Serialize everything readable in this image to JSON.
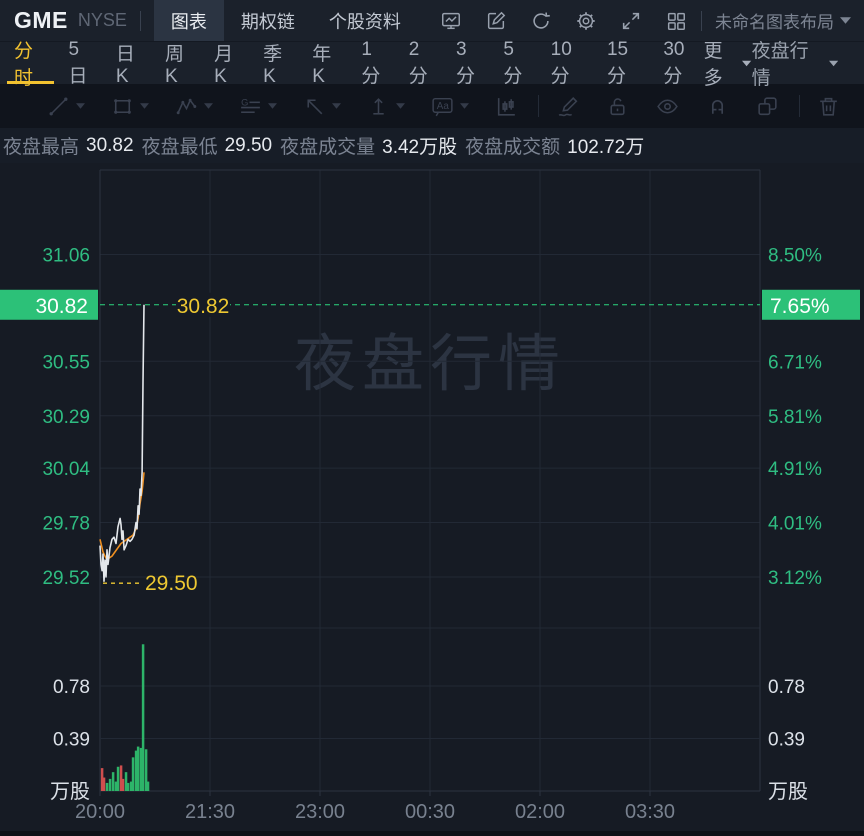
{
  "header": {
    "symbol": "GME",
    "exchange": "NYSE",
    "tabs": [
      {
        "label": "图表",
        "active": true
      },
      {
        "label": "期权链",
        "active": false
      },
      {
        "label": "个股资料",
        "active": false
      }
    ],
    "layout_name": "未命名图表布局"
  },
  "timeframe_bar": {
    "items": [
      {
        "label": "分时",
        "active": true
      },
      {
        "label": "5日"
      },
      {
        "label": "日K"
      },
      {
        "label": "周K"
      },
      {
        "label": "月K"
      },
      {
        "label": "季K"
      },
      {
        "label": "年K"
      },
      {
        "label": "1分"
      },
      {
        "label": "2分"
      },
      {
        "label": "3分"
      },
      {
        "label": "5分"
      },
      {
        "label": "10分"
      },
      {
        "label": "15分"
      },
      {
        "label": "30分"
      }
    ],
    "more_label": "更多",
    "session_selector": "夜盘行情"
  },
  "stats_bar": {
    "items": [
      {
        "label": "夜盘最高",
        "value": "30.82"
      },
      {
        "label": "夜盘最低",
        "value": "29.50"
      },
      {
        "label": "夜盘成交量",
        "value": "3.42万股"
      },
      {
        "label": "夜盘成交额",
        "value": "102.72万"
      }
    ]
  },
  "colors": {
    "text_green": "#2fbd82",
    "badge_green": "#2cc178",
    "dashed_green": "#2bd67e",
    "yellow": "#eec832",
    "orange_line": "#ee8f21",
    "price_line": "#e3e7eb",
    "vol_up_green": "#2db469",
    "vol_down_red": "#cf4e4e",
    "axis_time_text": "#78818f",
    "white_text": "#dce1e8",
    "grid": "#222935",
    "border": "#2c3340",
    "watermark": "#2c3442"
  },
  "chart_data": {
    "type": "line",
    "watermark": "夜盘行情",
    "x_ticks": [
      "20:00",
      "21:30",
      "23:00",
      "00:30",
      "02:00",
      "03:30"
    ],
    "session_minutes": 480,
    "y_axis": {
      "price_ticks": [
        "31.06",
        "30.55",
        "30.29",
        "30.04",
        "29.78",
        "29.52"
      ],
      "percent_ticks": [
        "8.50%",
        "6.71%",
        "5.81%",
        "4.91%",
        "4.01%",
        "3.12%"
      ],
      "price_top": 31.06,
      "price_bottom": 29.52,
      "current_price": "30.82",
      "current_percent": "7.65%",
      "current_price_value": 30.82
    },
    "markers": {
      "high": {
        "label": "30.82",
        "value": 30.82
      },
      "low": {
        "label": "29.50",
        "value": 29.5
      }
    },
    "volume_axis": {
      "ticks": [
        "0.78",
        "0.39"
      ],
      "values": [
        0.78,
        0.39
      ],
      "unit": "万股",
      "max": 1.2
    },
    "price_line": {
      "minutes": [
        0,
        0.7,
        1.5,
        2.2,
        2.9,
        3.6,
        4.4,
        5.1,
        5.8,
        7.3,
        8.7,
        10.2,
        11.6,
        13.1,
        14.6,
        15.3,
        16,
        16.7,
        17.5,
        18.9,
        20.4,
        21.8,
        23.3,
        24.8,
        26.2,
        26.9,
        27.7,
        28.4,
        29.1,
        29.8,
        30.6,
        31.3,
        32
      ],
      "price": [
        29.67,
        29.58,
        29.55,
        29.63,
        29.5,
        29.6,
        29.52,
        29.65,
        29.58,
        29.66,
        29.7,
        29.71,
        29.68,
        29.76,
        29.8,
        29.77,
        29.7,
        29.74,
        29.65,
        29.67,
        29.7,
        29.69,
        29.7,
        29.72,
        29.78,
        29.75,
        29.86,
        29.82,
        29.94,
        29.91,
        30.02,
        30.45,
        30.82
      ]
    },
    "avg_line": {
      "minutes": [
        0,
        2.2,
        4.4,
        6.5,
        8.7,
        10.9,
        13.1,
        15.3,
        17.5,
        19.6,
        21.8,
        24,
        26.2,
        27.7,
        29.1,
        30.6,
        31.3,
        32
      ],
      "price": [
        29.7,
        29.64,
        29.61,
        29.61,
        29.62,
        29.64,
        29.66,
        29.68,
        29.69,
        29.7,
        29.71,
        29.72,
        29.75,
        29.8,
        29.87,
        29.93,
        29.97,
        30.02
      ]
    },
    "volume_bars": [
      {
        "m": 1.5,
        "v": 0.17,
        "d": "down"
      },
      {
        "m": 2.9,
        "v": 0.1,
        "d": "down"
      },
      {
        "m": 5.1,
        "v": 0.06,
        "d": "up"
      },
      {
        "m": 7.3,
        "v": 0.09,
        "d": "up"
      },
      {
        "m": 9.5,
        "v": 0.14,
        "d": "up"
      },
      {
        "m": 11.6,
        "v": 0.07,
        "d": "up"
      },
      {
        "m": 13.1,
        "v": 0.18,
        "d": "up"
      },
      {
        "m": 15.3,
        "v": 0.19,
        "d": "down"
      },
      {
        "m": 16.7,
        "v": 0.09,
        "d": "down"
      },
      {
        "m": 18.9,
        "v": 0.14,
        "d": "up"
      },
      {
        "m": 20.4,
        "v": 0.06,
        "d": "up"
      },
      {
        "m": 22.6,
        "v": 0.07,
        "d": "up"
      },
      {
        "m": 24.0,
        "v": 0.25,
        "d": "up"
      },
      {
        "m": 26.2,
        "v": 0.3,
        "d": "up"
      },
      {
        "m": 27.7,
        "v": 0.33,
        "d": "up"
      },
      {
        "m": 29.8,
        "v": 0.32,
        "d": "up"
      },
      {
        "m": 31.3,
        "v": 1.09,
        "d": "up"
      },
      {
        "m": 33.5,
        "v": 0.31,
        "d": "up"
      },
      {
        "m": 34.9,
        "v": 0.07,
        "d": "up"
      }
    ]
  }
}
